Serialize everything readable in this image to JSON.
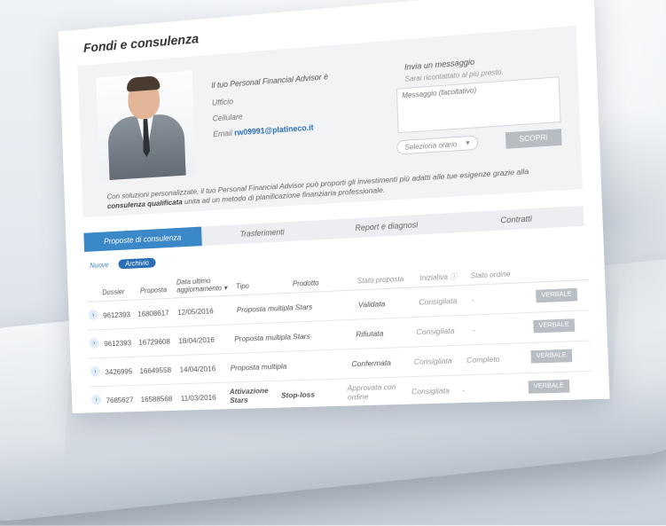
{
  "page": {
    "title": "Fondi e consulenza"
  },
  "advisor": {
    "intro": "Il tuo Personal Financial Advisor è",
    "office_label": "Ufficio",
    "mobile_label": "Cellulare",
    "email_label": "Email",
    "email": "rw09991@platineco.it",
    "description_prefix": "Con soluzioni personalizzate, il tuo Personal Financial Advisor può proporti gli investimenti più adatti alle tue esigenze grazie alla",
    "description_bold": "consulenza qualificata",
    "description_suffix": "unita ad un metodo di pianificazione finanziaria professionale."
  },
  "message": {
    "title": "Invia un messaggio",
    "subtitle": "Sarai ricontattato al più presto.",
    "placeholder": "Messaggio (facoltativo)",
    "time_select": "Seleziona orario",
    "submit": "SCOPRI"
  },
  "tabs": [
    {
      "label": "Proposte di consulenza",
      "active": true
    },
    {
      "label": "Trasferimenti",
      "active": false
    },
    {
      "label": "Report e diagnosi",
      "active": false
    },
    {
      "label": "Contratti",
      "active": false
    }
  ],
  "filters": {
    "new": "Nuove",
    "archive": "Archivio"
  },
  "table": {
    "headers": {
      "dossier": "Dossier",
      "proposal": "Proposta",
      "last_update": "Data ultimo aggiornamento",
      "type": "Tipo",
      "product": "Prodotto",
      "status": "Stato proposta",
      "initiative": "Iniziativa",
      "order_status": "Stato ordine"
    },
    "rows": [
      {
        "dossier": "9612393",
        "proposal": "16808617",
        "date": "12/05/2016",
        "type": "Proposta multipla Stars",
        "product": "",
        "status": "Validata",
        "initiative": "Consigliata",
        "order_status": "-",
        "action": "VERBALE"
      },
      {
        "dossier": "9612393",
        "proposal": "16729608",
        "date": "18/04/2016",
        "type": "Proposta multipla Stars",
        "product": "",
        "status": "Rifiutata",
        "initiative": "Consigliata",
        "order_status": "-",
        "action": "VERBALE"
      },
      {
        "dossier": "3426995",
        "proposal": "16649558",
        "date": "14/04/2016",
        "type": "Proposta multipla",
        "product": "",
        "status": "Confermata",
        "initiative": "Consigliata",
        "order_status": "Completo",
        "action": "VERBALE"
      },
      {
        "dossier": "7685627",
        "proposal": "16588568",
        "date": "11/03/2016",
        "type": "Attivazione Stars",
        "product": "Stop-loss",
        "status": "Approvata con ordine",
        "initiative": "Consigliata",
        "order_status": "-",
        "action": "VERBALE"
      }
    ]
  },
  "colors": {
    "accent": "#3b88c8",
    "link": "#2a6fb5",
    "button_gray": "#b9bec4"
  }
}
